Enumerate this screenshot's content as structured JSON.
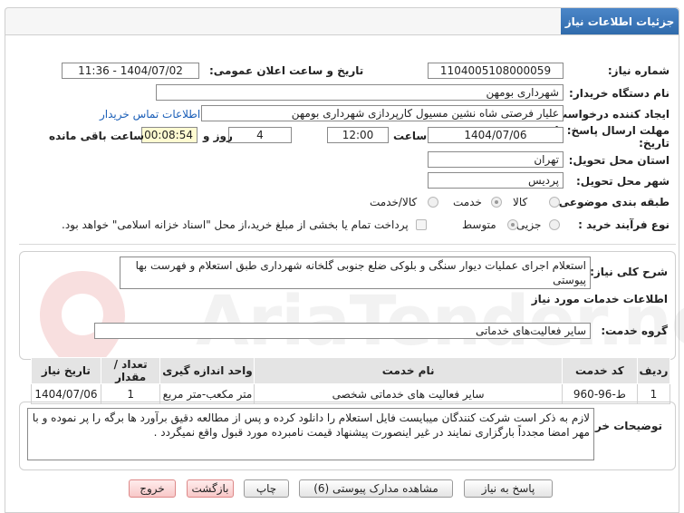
{
  "header": {
    "title": "جزئیات اطلاعات نیاز"
  },
  "form": {
    "need_number": {
      "label": "شماره نیاز:",
      "value": "1104005108000059"
    },
    "announce_datetime": {
      "label": "تاریخ و ساعت اعلان عمومی:",
      "value": "1404/07/02 - 11:36"
    },
    "buyer_org": {
      "label": "نام دستگاه خریدار:",
      "value": "شهرداری بومهن"
    },
    "requester": {
      "label": "ایجاد کننده درخواست:",
      "value": "علیار فرصتی شاه نشین مسیول کارپردازی شهرداری بومهن",
      "contact_link": "اطلاعات تماس خریدار"
    },
    "deadline": {
      "label_line1": "مهلت ارسال پاسخ: تا",
      "label_line2": "تاریخ:",
      "date": "1404/07/06",
      "time_label": "ساعت",
      "time": "12:00",
      "days": "4",
      "days_label": "روز و",
      "remaining": "00:08:54",
      "remaining_label": "ساعت باقی مانده"
    },
    "province": {
      "label": "استان محل تحویل:",
      "value": "تهران"
    },
    "city": {
      "label": "شهر محل تحویل:",
      "value": "پردیس"
    },
    "category": {
      "label": "طبقه بندی موضوعی:",
      "options": [
        "کالا",
        "خدمت",
        "کالا/خدمت"
      ],
      "selected": "خدمت"
    },
    "process": {
      "label": "نوع فرآیند خرید :",
      "options": [
        "جزیی",
        "متوسط"
      ],
      "selected": "متوسط",
      "treasury_note": "پرداخت تمام یا بخشی از مبلغ خرید،از محل \"اسناد خزانه اسلامی\" خواهد بود."
    }
  },
  "summary": {
    "label": "شرح کلی نیاز:",
    "text": "استعلام اجرای عملیات دیوار سنگی و بلوکی ضلع جنوبی گلخانه شهرداری طبق استعلام و فهرست بها پیوستی"
  },
  "services": {
    "section_title": "اطلاعات خدمات مورد نیاز",
    "group_label": "گروه خدمت:",
    "group_value": "سایر فعالیت‌های خدماتی",
    "columns": [
      "ردیف",
      "کد خدمت",
      "نام خدمت",
      "واحد اندازه گیری",
      "تعداد / مقدار",
      "تاریخ نیاز"
    ],
    "rows": [
      [
        "1",
        "ط-96-960",
        "سایر فعالیت های خدماتی شخصی",
        "متر مکعب-متر مربع",
        "1",
        "1404/07/06"
      ]
    ]
  },
  "buyer_notes": {
    "label": "توضیحات خریدار:",
    "text": "لازم به ذکر است شرکت کنندگان میبایست فایل استعلام را دانلود کرده و پس از مطالعه دقیق برآورد ها برگه را پر نموده و با مهر امضا مجدداً بارگزاری نمایند در غیر اینصورت پیشنهاد قیمت نامبرده مورد قبول واقع نمیگردد ."
  },
  "buttons": {
    "reply": "پاسخ به نیاز",
    "view_docs": "مشاهده مدارک پیوستی (6)",
    "print": "چاپ",
    "back": "بازگشت",
    "exit": "خروج"
  },
  "watermark": {
    "text": "AriaTender.net"
  }
}
